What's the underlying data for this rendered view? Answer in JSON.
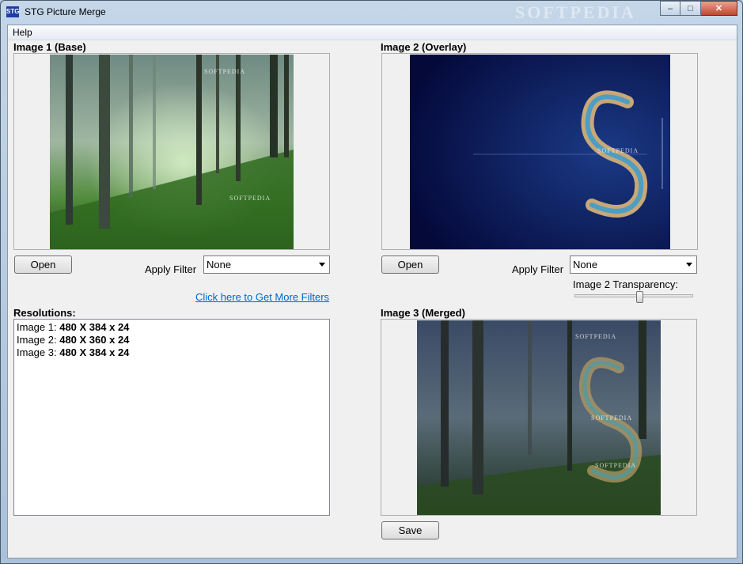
{
  "window": {
    "title": "STG Picture Merge",
    "app_icon_text": "STG",
    "watermark": "SOFTPEDIA",
    "buttons": {
      "minimize": "–",
      "maximize": "□",
      "close": "✕"
    }
  },
  "menu": {
    "items": [
      {
        "label": "Help"
      }
    ]
  },
  "image1": {
    "label": "Image 1 (Base)",
    "open_label": "Open",
    "filter_label": "Apply Filter",
    "filter_value": "None",
    "more_filters_link": "Click here to Get More Filters",
    "watermark": "SOFTPEDIA"
  },
  "image2": {
    "label": "Image 2 (Overlay)",
    "open_label": "Open",
    "filter_label": "Apply Filter",
    "filter_value": "None",
    "transparency_label": "Image 2 Transparency:",
    "transparency_level": 0.55,
    "watermark": "SOFTPEDIA"
  },
  "image3": {
    "label": "Image 3 (Merged)",
    "save_label": "Save",
    "watermark": "SOFTPEDIA"
  },
  "resolutions": {
    "label": "Resolutions:",
    "rows": [
      {
        "name": "Image 1:",
        "value": "480 X 384 x 24"
      },
      {
        "name": "Image 2:",
        "value": "480 X 360 x 24"
      },
      {
        "name": "Image 3:",
        "value": "480 X 384 x 24"
      }
    ]
  },
  "colors": {
    "link": "#0066cc",
    "window_frame": "#b9cde0",
    "client_bg": "#f0f0f0"
  }
}
